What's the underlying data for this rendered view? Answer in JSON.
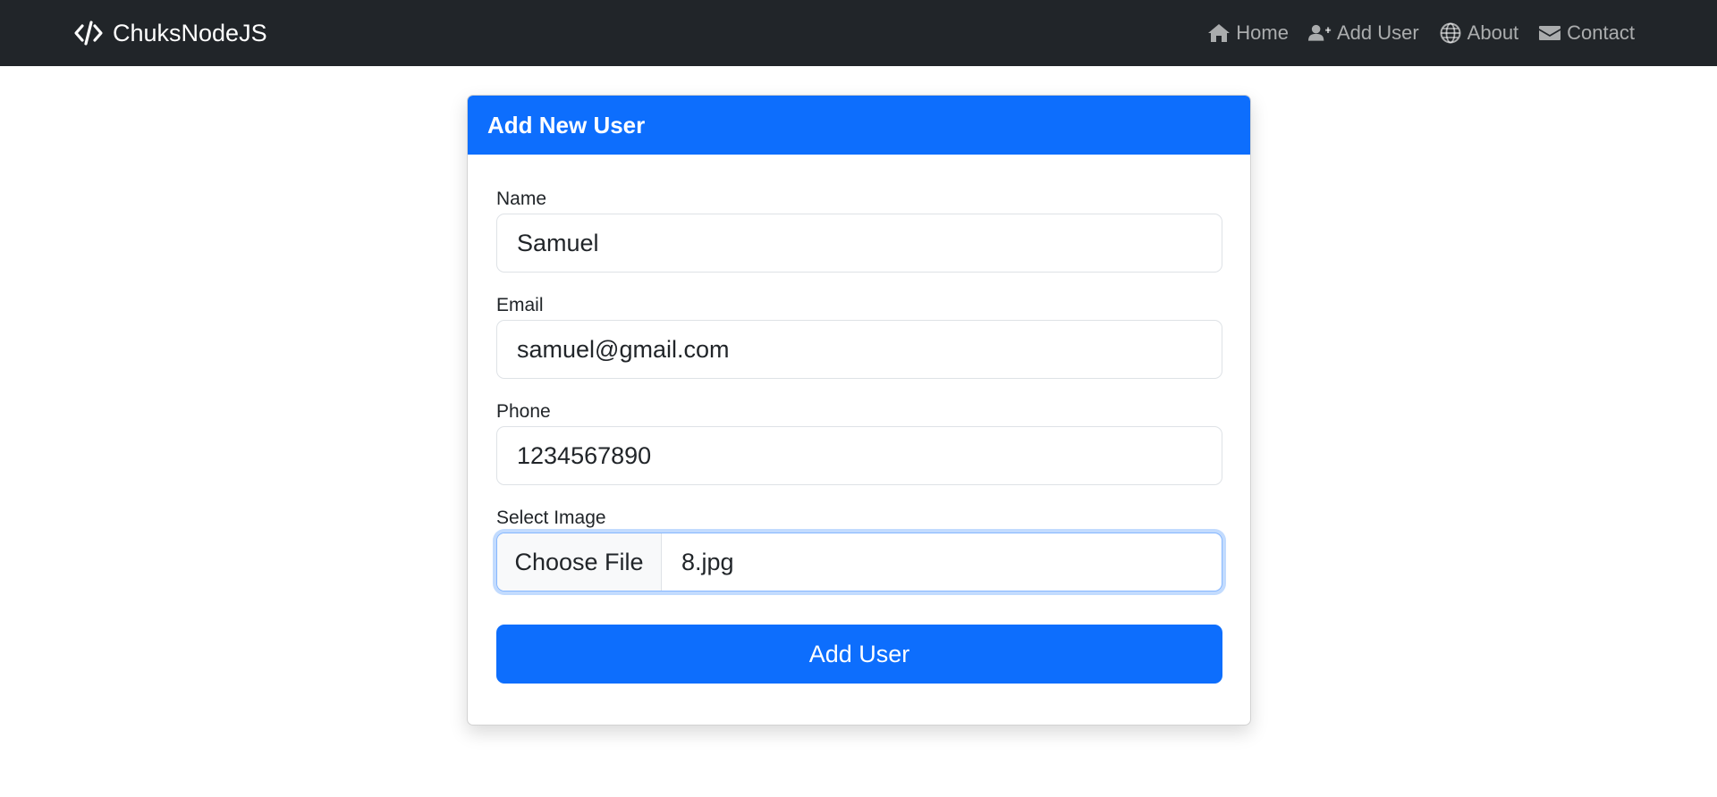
{
  "navbar": {
    "brand": "ChuksNodeJS",
    "brand_icon": "code-icon",
    "links": [
      {
        "label": "Home",
        "icon": "home-icon"
      },
      {
        "label": "Add User",
        "icon": "user-plus-icon"
      },
      {
        "label": "About",
        "icon": "globe-icon"
      },
      {
        "label": "Contact",
        "icon": "envelope-icon"
      }
    ]
  },
  "form": {
    "title": "Add New User",
    "name_label": "Name",
    "name_value": "Samuel",
    "email_label": "Email",
    "email_value": "samuel@gmail.com",
    "phone_label": "Phone",
    "phone_value": "1234567890",
    "image_label": "Select Image",
    "choose_file_label": "Choose File",
    "file_name": "8.jpg",
    "submit_label": "Add User"
  },
  "colors": {
    "navbar_bg": "#212529",
    "primary": "#0d6efd"
  }
}
